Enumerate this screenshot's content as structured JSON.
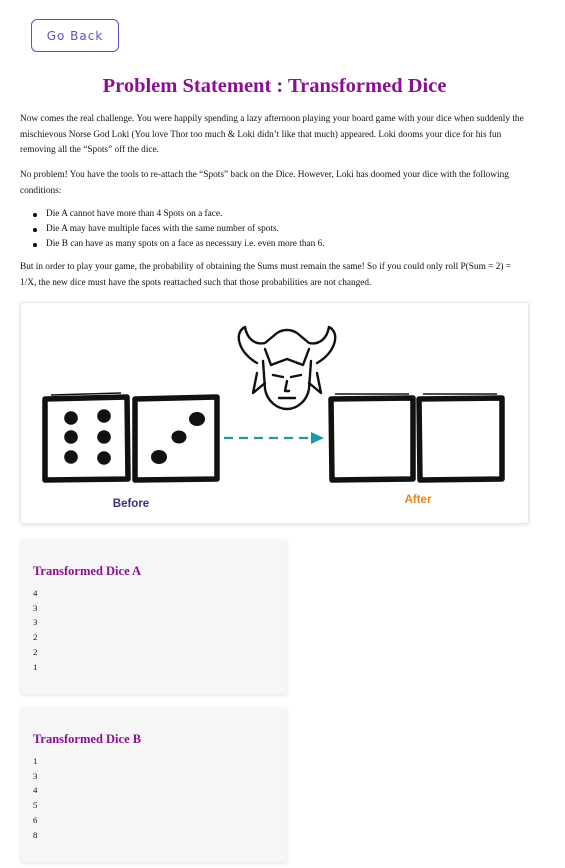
{
  "back_button": "Go Back",
  "title": "Problem Statement : Transformed Dice",
  "paragraphs": {
    "p1": "Now comes the real challenge. You were happily spending a lazy afternoon playing your board game with your dice when suddenly the mischievous Norse God Loki (You love Thor too much & Loki didn’t like that much) appeared. Loki dooms your dice for his fun removing all the “Spots” off the dice.",
    "p2": "No problem! You have the tools to re-attach the “Spots” back on the Dice. However, Loki has doomed your dice with the following conditions:",
    "p3": "But in order to play your game, the probability of obtaining the Sums must remain the same! So if you could only roll P(Sum = 2) = 1/X, the new dice must have the spots reattached such that those probabilities are not changed."
  },
  "conditions": [
    "Die A cannot have more than 4 Spots on a face.",
    "Die A may have multiple faces with the same number of spots.",
    "Die B can have as many spots on a face as necessary i.e. even more than 6."
  ],
  "diagram": {
    "before_label": "Before",
    "after_label": "After",
    "before_color": "#3b2f7a",
    "after_color": "#e8821e",
    "arrow_color": "#1a9aa8",
    "before_dice": [
      6,
      3
    ],
    "icons": [
      "loki-icon",
      "arrow-icon"
    ]
  },
  "dice_a": {
    "title": "Transformed Dice A",
    "faces": [
      "4",
      "3",
      "3",
      "2",
      "2",
      "1"
    ]
  },
  "dice_b": {
    "title": "Transformed Dice B",
    "faces": [
      "1",
      "3",
      "4",
      "5",
      "6",
      "8"
    ]
  },
  "colors": {
    "accent": "#8a1090",
    "button": "#6a4cc4"
  }
}
